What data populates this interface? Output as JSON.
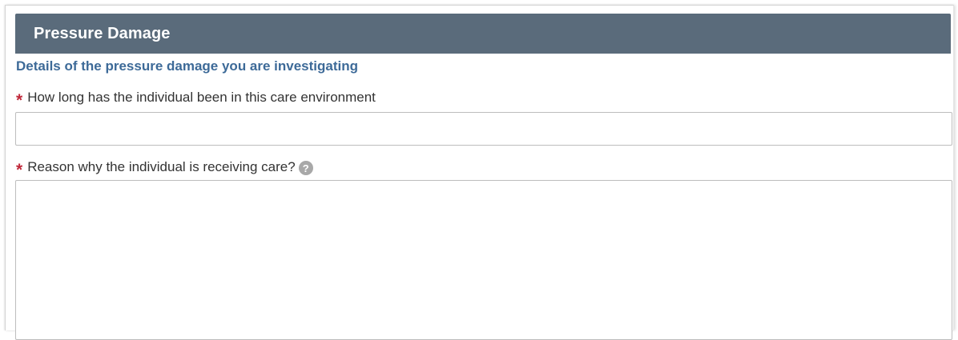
{
  "section": {
    "title": "Pressure Damage",
    "subtitle": "Details of the pressure damage you are investigating"
  },
  "fields": [
    {
      "required_marker": "*",
      "label": "How long has the individual been in this care environment",
      "value": "",
      "placeholder": ""
    },
    {
      "required_marker": "*",
      "label": "Reason why the individual is receiving care?",
      "help_icon": "question-mark-circle-icon",
      "help_glyph": "?",
      "value": "",
      "placeholder": ""
    }
  ],
  "colors": {
    "header_bg": "#5a6b7b",
    "subtitle": "#3d6a98",
    "required_star": "#c0283a"
  }
}
